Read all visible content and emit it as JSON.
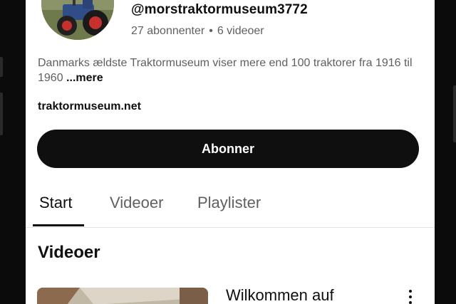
{
  "channel": {
    "handle": "@morstraktormuseum3772",
    "subscribers": "27 abonnenter",
    "separator": "•",
    "videos_count": "6 videoer",
    "description": "Danmarks ældste Traktormuseum viser mere end 100 traktorer fra 1916 til 1960",
    "more_label": "...mere",
    "link": "traktormuseum.net"
  },
  "subscribe_label": "Abonner",
  "tabs": [
    {
      "label": "Start",
      "active": true
    },
    {
      "label": "Videoer",
      "active": false
    },
    {
      "label": "Playlister",
      "active": false
    }
  ],
  "section_title": "Videoer",
  "video": {
    "title": "Wilkommen auf"
  },
  "icons": {
    "more": "vertical-dots-icon"
  },
  "colors": {
    "text_primary": "#0f0f0f",
    "text_secondary": "#606060",
    "button_bg": "#0f0f0f",
    "button_text": "#ffffff"
  }
}
